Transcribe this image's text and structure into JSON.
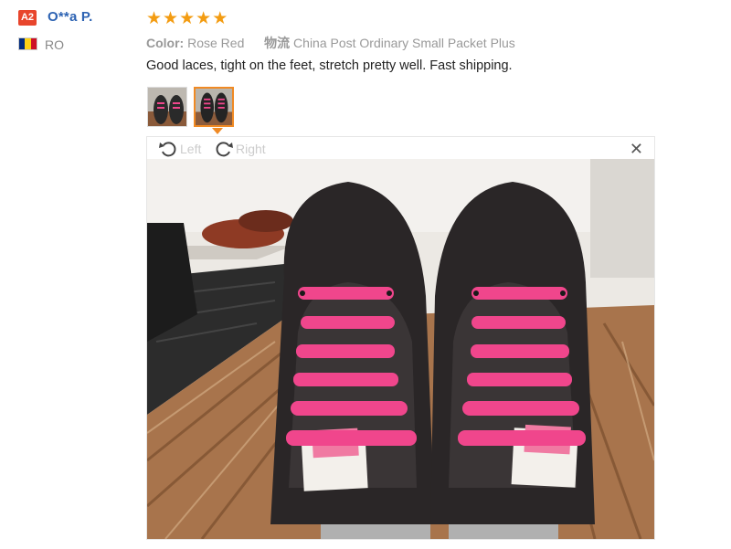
{
  "reviewer": {
    "badge": "A2",
    "name": "O**a P.",
    "country": "RO",
    "flag_colors": [
      "#002b7f",
      "#fcd116",
      "#ce1126"
    ]
  },
  "review": {
    "rating": 5,
    "rating_max": 5,
    "star_color": "#f39c12",
    "color_label": "Color:",
    "color_value": "Rose Red",
    "shipping_label": "物流",
    "shipping_value": "China Post Ordinary Small Packet Plus",
    "text": "Good laces, tight on the feet, stretch pretty well. Fast shipping."
  },
  "gallery": {
    "thumbnails": [
      "photo-1",
      "photo-2"
    ],
    "active_index": 1,
    "accent": "#f08a24"
  },
  "viewer": {
    "rotate_left_label": "Left",
    "rotate_right_label": "Right",
    "close_icon": "close-icon",
    "lace_color": "#f0468c"
  }
}
